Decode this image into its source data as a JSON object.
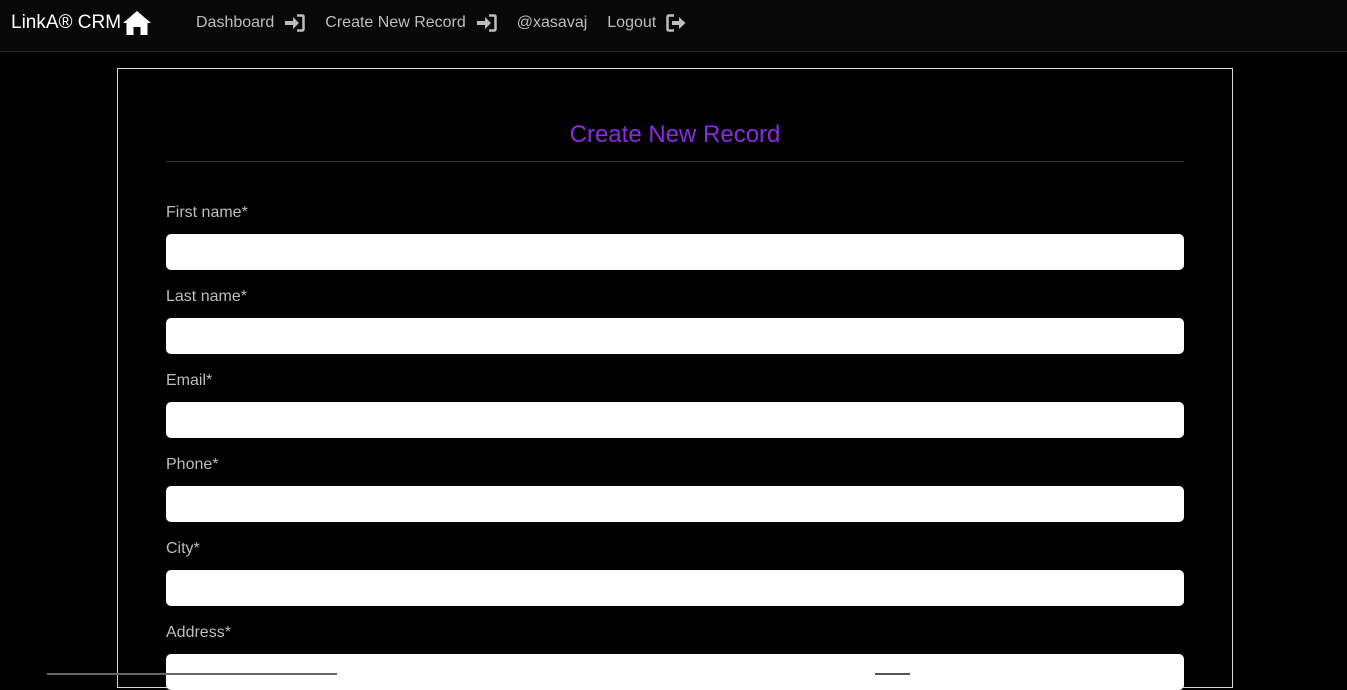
{
  "navbar": {
    "brand": "LinkA® CRM",
    "links": [
      {
        "label": "Dashboard",
        "icon": "sign-in-icon"
      },
      {
        "label": "Create New Record",
        "icon": "sign-in-icon"
      },
      {
        "label": "@xasavaj",
        "icon": ""
      },
      {
        "label": "Logout",
        "icon": "sign-out-icon"
      }
    ]
  },
  "form": {
    "title": "Create New Record",
    "fields": [
      {
        "label": "First name*",
        "value": "",
        "placeholder": ""
      },
      {
        "label": "Last name*",
        "value": "",
        "placeholder": ""
      },
      {
        "label": "Email*",
        "value": "",
        "placeholder": ""
      },
      {
        "label": "Phone*",
        "value": "",
        "placeholder": ""
      },
      {
        "label": "City*",
        "value": "",
        "placeholder": ""
      },
      {
        "label": "Address*",
        "value": "",
        "placeholder": ""
      }
    ]
  },
  "colors": {
    "background": "#000000",
    "navbar": "#080808",
    "title_accent": "#8a2be2",
    "nav_text": "#bdbdbd"
  }
}
